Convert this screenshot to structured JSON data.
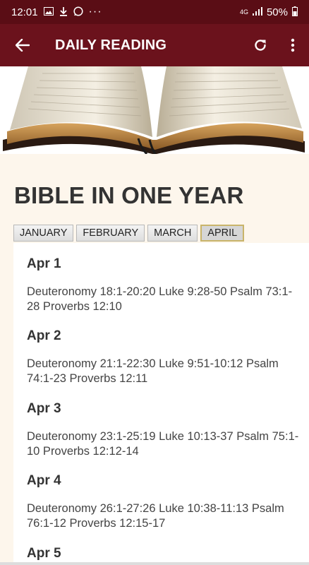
{
  "status_bar": {
    "time": "12:01",
    "network": "4G",
    "battery": "50%"
  },
  "app_bar": {
    "title": "DAILY READING"
  },
  "page": {
    "title": "BIBLE IN ONE YEAR"
  },
  "months": [
    {
      "label": "JANUARY",
      "active": false
    },
    {
      "label": "FEBRUARY",
      "active": false
    },
    {
      "label": "MARCH",
      "active": false
    },
    {
      "label": "APRIL",
      "active": true
    }
  ],
  "readings": [
    {
      "date": "Apr 1",
      "text": "Deuteronomy 18:1-20:20 Luke 9:28-50 Psalm 73:1-28 Proverbs 12:10"
    },
    {
      "date": "Apr 2",
      "text": "Deuteronomy 21:1-22:30 Luke 9:51-10:12 Psalm 74:1-23 Proverbs 12:11"
    },
    {
      "date": "Apr 3",
      "text": "Deuteronomy 23:1-25:19 Luke 10:13-37 Psalm 75:1-10 Proverbs 12:12-14"
    },
    {
      "date": "Apr 4",
      "text": "Deuteronomy 26:1-27:26 Luke 10:38-11:13 Psalm 76:1-12 Proverbs 12:15-17"
    },
    {
      "date": "Apr 5",
      "text": ""
    }
  ],
  "colors": {
    "app_bar": "#6b121c",
    "status_bar": "#5a0d15",
    "background": "#fdf6ec"
  }
}
